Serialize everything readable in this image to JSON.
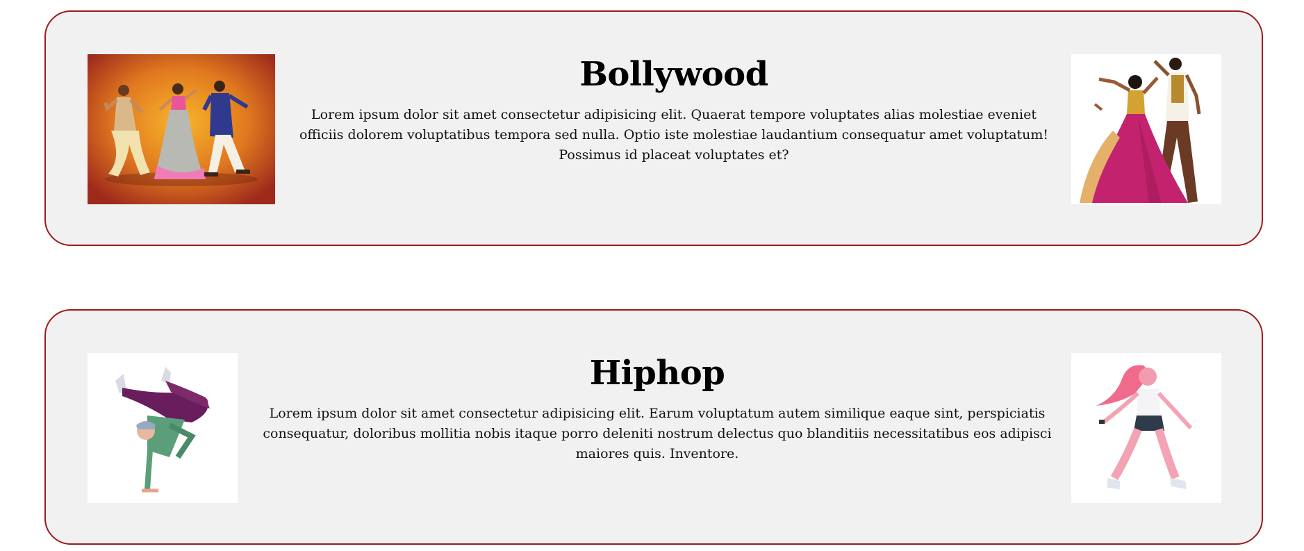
{
  "cards": [
    {
      "title": "Bollywood",
      "description": "Lorem ipsum dolor sit amet consectetur adipisicing elit. Quaerat tempore voluptates alias molestiae eveniet officiis dolorem voluptatibus tempora sed nulla. Optio iste molestiae laudantium consequatur amet voluptatum! Possimus id placeat voluptates et?",
      "left_image": "bollywood-group-dancers-illustration",
      "right_image": "bollywood-couple-dancers-illustration"
    },
    {
      "title": "Hiphop",
      "description": "Lorem ipsum dolor sit amet consectetur adipisicing elit. Earum voluptatum autem similique eaque sint, perspiciatis consequatur, doloribus mollitia nobis itaque porro deleniti nostrum delectus quo blanditiis necessitatibus eos adipisci maiores quis. Inventore.",
      "left_image": "breakdancer-handstand-illustration",
      "right_image": "female-hiphop-dancer-illustration"
    }
  ],
  "colors": {
    "card_border": "#9b1b1b",
    "card_background": "#f1f1f1",
    "page_background": "#ffffff"
  }
}
